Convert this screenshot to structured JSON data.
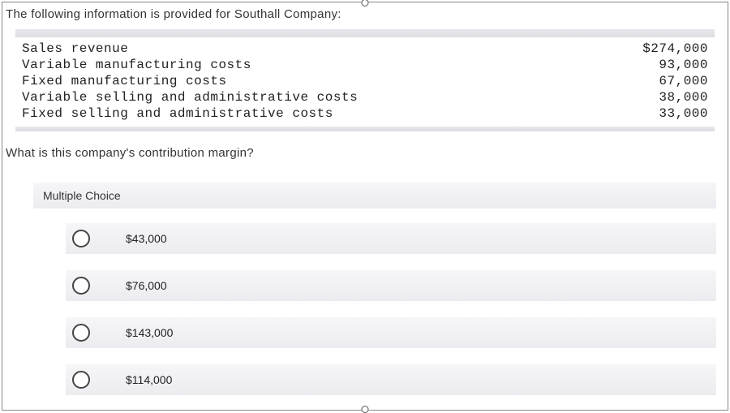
{
  "intro": "The following information is provided for Southall Company:",
  "data_rows": [
    {
      "label": "Sales revenue",
      "value": "$274,000"
    },
    {
      "label": "Variable manufacturing costs",
      "value": "93,000"
    },
    {
      "label": "Fixed manufacturing costs",
      "value": "67,000"
    },
    {
      "label": "Variable selling and administrative costs",
      "value": "38,000"
    },
    {
      "label": "Fixed selling and administrative costs",
      "value": "33,000"
    }
  ],
  "question": "What is this company's contribution margin?",
  "mc_title": "Multiple Choice",
  "options": [
    {
      "label": "$43,000"
    },
    {
      "label": "$76,000"
    },
    {
      "label": "$143,000"
    },
    {
      "label": "$114,000"
    }
  ]
}
